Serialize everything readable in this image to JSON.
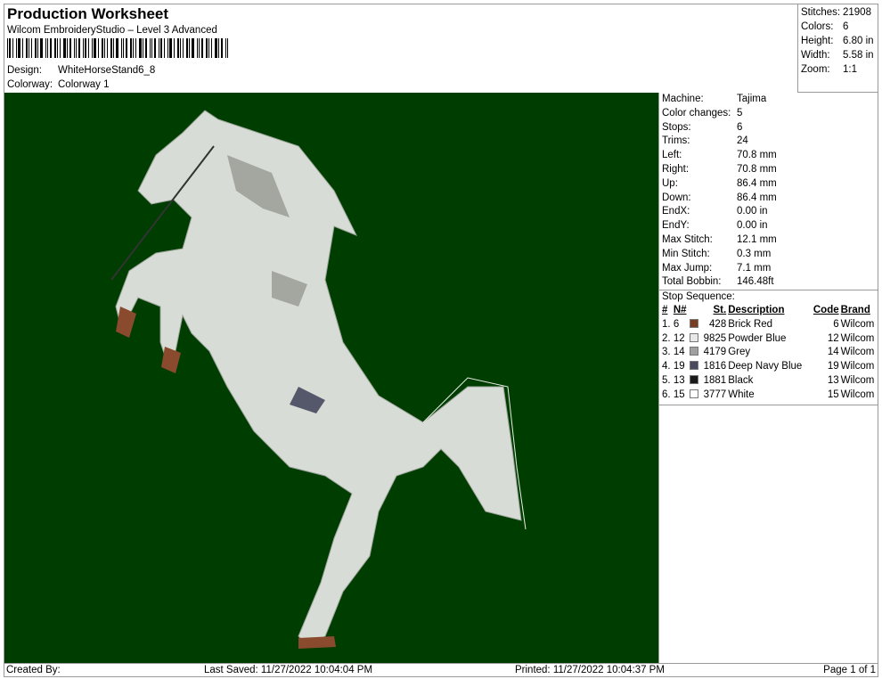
{
  "header": {
    "title": "Production Worksheet",
    "subtitle": "Wilcom EmbroideryStudio – Level 3 Advanced",
    "design_label": "Design:",
    "design": "WhiteHorseStand6_8",
    "colorway_label": "Colorway:",
    "colorway": "Colorway 1"
  },
  "stats": [
    {
      "k": "Stitches:",
      "v": "21908"
    },
    {
      "k": "Colors:",
      "v": "6"
    },
    {
      "k": "Height:",
      "v": "6.80 in"
    },
    {
      "k": "Width:",
      "v": "5.58 in"
    },
    {
      "k": "Zoom:",
      "v": "1:1"
    }
  ],
  "design_area": {
    "background": "#003d00"
  },
  "machine": [
    {
      "k": "Machine:",
      "v": "Tajima"
    },
    {
      "k": "Color changes:",
      "v": "5"
    },
    {
      "k": "Stops:",
      "v": "6"
    },
    {
      "k": "Trims:",
      "v": "24"
    },
    {
      "k": "Left:",
      "v": "70.8 mm"
    },
    {
      "k": "Right:",
      "v": "70.8 mm"
    },
    {
      "k": "Up:",
      "v": "86.4 mm"
    },
    {
      "k": "Down:",
      "v": "86.4 mm"
    },
    {
      "k": "EndX:",
      "v": "0.00 in"
    },
    {
      "k": "EndY:",
      "v": "0.00 in"
    },
    {
      "k": "Max Stitch:",
      "v": "12.1 mm"
    },
    {
      "k": "Min Stitch:",
      "v": "0.3 mm"
    },
    {
      "k": "Max Jump:",
      "v": "7.1 mm"
    },
    {
      "k": "Total Bobbin:",
      "v": "146.48ft"
    }
  ],
  "stop_sequence": {
    "label": "Stop Sequence:",
    "headers": {
      "num": "#",
      "n": "N#",
      "st": "St.",
      "desc": "Description",
      "code": "Code",
      "brand": "Brand"
    },
    "rows": [
      {
        "num": "1.",
        "n": "6",
        "color": "#7a3e22",
        "st": "428",
        "desc": "Brick Red",
        "code": "6",
        "brand": "Wilcom"
      },
      {
        "num": "2.",
        "n": "12",
        "color": "#e8e8e8",
        "st": "9825",
        "desc": "Powder Blue",
        "code": "12",
        "brand": "Wilcom"
      },
      {
        "num": "3.",
        "n": "14",
        "color": "#a0a0a0",
        "st": "4179",
        "desc": "Grey",
        "code": "14",
        "brand": "Wilcom"
      },
      {
        "num": "4.",
        "n": "19",
        "color": "#4a4a5e",
        "st": "1816",
        "desc": "Deep Navy Blue",
        "code": "19",
        "brand": "Wilcom"
      },
      {
        "num": "5.",
        "n": "13",
        "color": "#1a1a1a",
        "st": "1881",
        "desc": "Black",
        "code": "13",
        "brand": "Wilcom"
      },
      {
        "num": "6.",
        "n": "15",
        "color": "#ffffff",
        "st": "3777",
        "desc": "White",
        "code": "15",
        "brand": "Wilcom"
      }
    ]
  },
  "footer": {
    "created": "Created By:",
    "saved": "Last Saved: 11/27/2022 10:04:04 PM",
    "printed": "Printed: 11/27/2022 10:04:37 PM",
    "page": "Page 1 of 1"
  }
}
